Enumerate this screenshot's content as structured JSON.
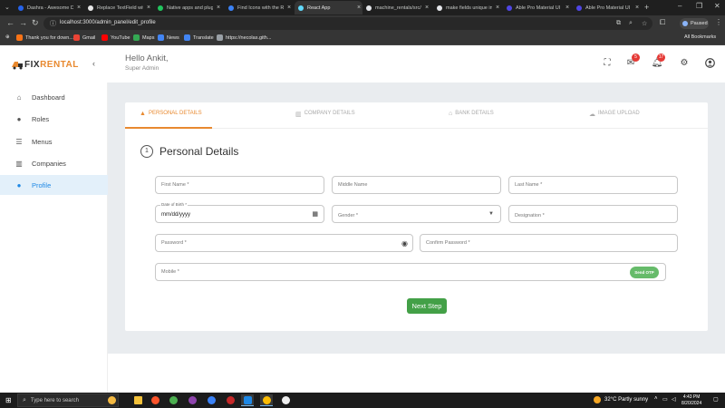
{
  "browser": {
    "tabs": [
      {
        "title": "Dashra - Awesome D",
        "color": "#2563eb",
        "active": false
      },
      {
        "title": "Replace TextField wit",
        "color": "#e8e8e8",
        "active": false
      },
      {
        "title": "Native apps and plug",
        "color": "#22c55e",
        "active": false
      },
      {
        "title": "Find Icons with the R",
        "color": "#3b82f6",
        "active": false
      },
      {
        "title": "React App",
        "color": "#61dafb",
        "active": true
      },
      {
        "title": "machine_rentals/src/",
        "color": "#e5e7eb",
        "active": false
      },
      {
        "title": "make fields unique in",
        "color": "#e5e7eb",
        "active": false
      },
      {
        "title": "Able Pro Material UI",
        "color": "#4f46e5",
        "active": false
      },
      {
        "title": "Able Pro Material UI",
        "color": "#4f46e5",
        "active": false
      }
    ],
    "url": "localhost:3000/admin_panel/edit_profile",
    "profile_status": "Paused",
    "bookmarks": [
      {
        "label": "Thank you for down...",
        "color": "#f97316"
      },
      {
        "label": "Gmail",
        "color": "#ea4335"
      },
      {
        "label": "YouTube",
        "color": "#ff0000"
      },
      {
        "label": "Maps",
        "color": "#34a853"
      },
      {
        "label": "News",
        "color": "#4285f4"
      },
      {
        "label": "Translate",
        "color": "#4285f4"
      },
      {
        "label": "https://necolas.gith...",
        "color": "#9aa0a6"
      }
    ],
    "all_bookmarks": "All Bookmarks"
  },
  "app": {
    "brand_prefix": "FIX",
    "brand_suffix": "RENTAL",
    "greeting": "Hello Ankit,",
    "role": "Super Admin",
    "mail_count": "5",
    "notification_count": "17",
    "accent_color": "#e8892f",
    "success_color": "#43a047"
  },
  "sidebar": {
    "items": [
      {
        "label": "Dashboard",
        "icon": "home-icon",
        "active": false
      },
      {
        "label": "Roles",
        "icon": "person-icon",
        "active": false
      },
      {
        "label": "Menus",
        "icon": "list-icon",
        "active": false
      },
      {
        "label": "Companies",
        "icon": "building-icon",
        "active": false
      },
      {
        "label": "Profile",
        "icon": "person-icon",
        "active": true
      }
    ]
  },
  "steps": [
    {
      "label": "PERSONAL DETAILS",
      "icon": "person-icon",
      "active": true
    },
    {
      "label": "COMPANY DETAILS",
      "icon": "building-icon",
      "active": false
    },
    {
      "label": "BANK DETAILS",
      "icon": "bank-icon",
      "active": false
    },
    {
      "label": "IMAGE UPLOAD",
      "icon": "cloud-upload-icon",
      "active": false
    }
  ],
  "form": {
    "step_number": "1",
    "section_title": "Personal Details",
    "first_name": "First Name *",
    "middle_name": "Middle Name",
    "last_name": "Last Name *",
    "dob_label": "Date of Birth *",
    "dob_value": "mm/dd/yyyy",
    "gender": "Gender *",
    "designation": "Designation *",
    "password": "Password *",
    "confirm_password": "Confirm Password *",
    "mobile": "Mobile *",
    "send_otp": "Send OTP",
    "next_step": "Next Step"
  },
  "taskbar": {
    "search_placeholder": "Type here to search",
    "weather_temp": "32°C",
    "weather_text": "Partly sunny",
    "time": "4:43 PM",
    "date": "8/20/2024"
  }
}
